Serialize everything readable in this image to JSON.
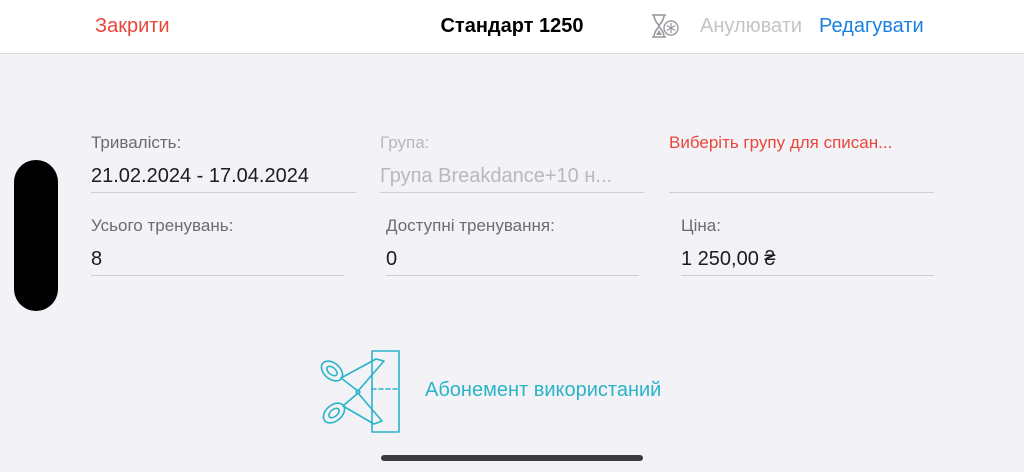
{
  "navbar": {
    "close_label": "Закрити",
    "title": "Стандарт 1250",
    "freeze_icon": "hourglass-snowflake-icon",
    "cancel_label": "Анулювати",
    "edit_label": "Редагувати"
  },
  "fields": {
    "duration": {
      "label": "Тривалість:",
      "value": "21.02.2024 - 17.04.2024"
    },
    "group": {
      "label": "Група:",
      "value": "Група Breakdance+10 н..."
    },
    "select_group": {
      "label": "Виберіть групу для списан..."
    },
    "total_trainings": {
      "label": "Усього тренувань:",
      "value": "8"
    },
    "available_trainings": {
      "label": "Доступні тренування:",
      "value": "0"
    },
    "price": {
      "label": "Ціна:",
      "value": "1 250,00 ₴"
    }
  },
  "status": {
    "icon": "cut-ticket-icon",
    "text": "Абонемент використаний"
  },
  "colors": {
    "close": "#e8473b",
    "edit": "#1a7fe0",
    "disabled": "#c4c4c8",
    "warning": "#e8473b",
    "status": "#2ab4c8"
  }
}
